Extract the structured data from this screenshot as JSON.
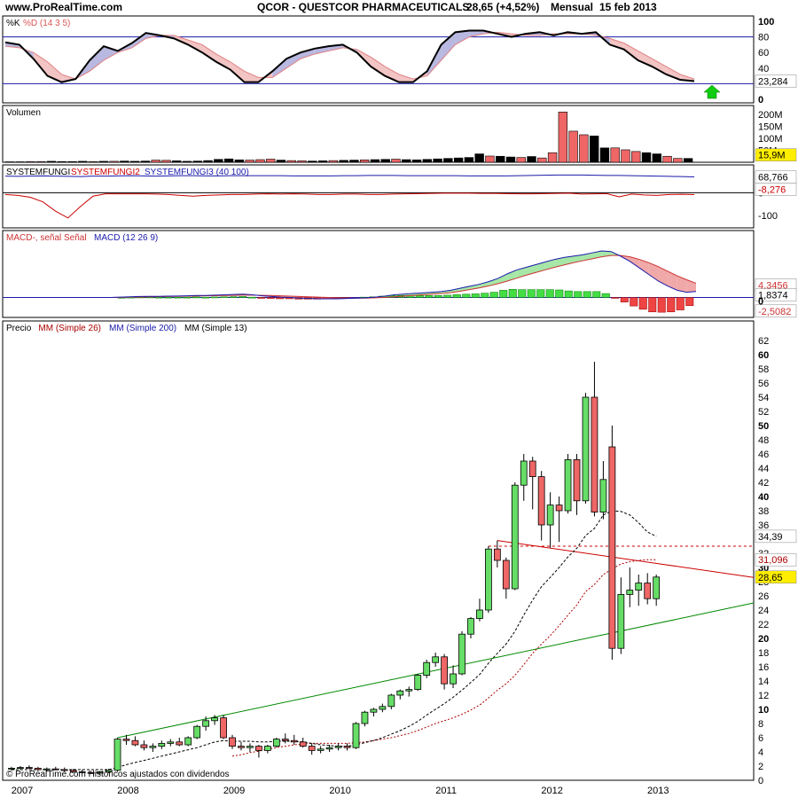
{
  "header": {
    "site": "www.ProRealTime.com",
    "instrument": "QCOR - QUESTCOR PHARMACEUTICALS",
    "price_change": "28,65 (+4,52%)",
    "period": "Mensual",
    "date": "15 feb 2013"
  },
  "footer_note": "© ProRealTime.com  Históricos ajustados con dividendos",
  "colors": {
    "up": "#66dd66",
    "down": "#ee6666",
    "frame": "#000000",
    "blue": "#1a1aaa",
    "red": "#cc0000",
    "green": "#008800"
  },
  "panels": {
    "stoch": {
      "label_k": "%K",
      "label_d": "%D (14 3 5)",
      "ticks": [
        "100",
        "80",
        "60",
        "40",
        "20",
        "0"
      ],
      "value": "23,284"
    },
    "volume": {
      "label": "Volumen",
      "ticks": [
        "200M",
        "150M",
        "100M",
        "50M"
      ],
      "value": "15,9M"
    },
    "systemfungi": {
      "label_1": "SYSTEMFUNGI",
      "label_2": "SYSTEMFUNGI2",
      "label_3": "SYSTEMFUNGI3 (40 100)",
      "ticks": [
        "0",
        "-100"
      ],
      "value_1": "68,766",
      "value_2": "-8,276"
    },
    "macd": {
      "label_1": "MACD-, señal",
      "label_2": "Señal",
      "label_3": "MACD (12 26 9)",
      "ticks": [
        "0"
      ],
      "value_1": "4,3456",
      "value_2": "1,8374",
      "value_3": "-2,5082"
    },
    "price": {
      "label_1": "Precio",
      "label_2": "MM (Simple 26)",
      "label_3": "MM (Simple 200)",
      "label_4": "MM (Simple 13)",
      "value_ma13": "34,39",
      "value_ma26": "31,096",
      "value_last": "28,65"
    }
  },
  "chart_data": {
    "type": "candlestick",
    "x_labels": [
      "2007",
      "2008",
      "2009",
      "2010",
      "2011",
      "2012",
      "2013"
    ],
    "y_ticks": [
      0,
      2,
      4,
      6,
      8,
      10,
      12,
      14,
      16,
      18,
      20,
      22,
      24,
      26,
      28,
      30,
      32,
      34,
      36,
      38,
      40,
      42,
      44,
      46,
      48,
      50,
      52,
      54,
      56,
      58,
      60,
      62
    ],
    "y_range": [
      0,
      63
    ],
    "start_year": 2007,
    "candles_ohlc": [
      [
        1.6,
        1.9,
        1.4,
        1.7
      ],
      [
        1.7,
        2.0,
        1.5,
        1.8
      ],
      [
        1.8,
        2.1,
        1.6,
        1.7
      ],
      [
        1.7,
        1.9,
        1.3,
        1.5
      ],
      [
        1.5,
        1.8,
        1.2,
        1.6
      ],
      [
        1.6,
        1.9,
        1.4,
        1.5
      ],
      [
        1.5,
        1.8,
        1.2,
        1.4
      ],
      [
        1.4,
        1.6,
        1.1,
        1.2
      ],
      [
        1.2,
        1.5,
        1.0,
        1.1
      ],
      [
        1.1,
        1.3,
        0.9,
        1.0
      ],
      [
        1.0,
        1.3,
        0.8,
        1.2
      ],
      [
        1.2,
        1.6,
        1.0,
        1.4
      ],
      [
        1.4,
        6.0,
        1.2,
        5.8
      ],
      [
        5.8,
        6.4,
        5.0,
        5.6
      ],
      [
        5.6,
        6.2,
        4.8,
        5.0
      ],
      [
        5.0,
        5.6,
        4.2,
        4.6
      ],
      [
        4.6,
        5.2,
        4.0,
        4.8
      ],
      [
        4.8,
        5.6,
        4.4,
        5.2
      ],
      [
        5.2,
        5.8,
        4.8,
        5.4
      ],
      [
        5.4,
        6.0,
        4.8,
        5.0
      ],
      [
        5.0,
        6.2,
        4.8,
        6.0
      ],
      [
        6.0,
        7.8,
        5.8,
        7.6
      ],
      [
        7.6,
        9.0,
        7.0,
        8.4
      ],
      [
        8.4,
        9.2,
        7.8,
        8.8
      ],
      [
        8.8,
        9.2,
        5.8,
        6.0
      ],
      [
        6.0,
        6.4,
        4.4,
        4.8
      ],
      [
        4.8,
        5.4,
        4.2,
        4.6
      ],
      [
        4.6,
        5.2,
        4.0,
        4.8
      ],
      [
        4.8,
        5.0,
        3.2,
        4.2
      ],
      [
        4.2,
        5.0,
        3.8,
        4.8
      ],
      [
        4.8,
        6.0,
        4.6,
        5.8
      ],
      [
        5.8,
        6.6,
        5.2,
        5.6
      ],
      [
        5.6,
        6.4,
        5.0,
        5.4
      ],
      [
        5.4,
        6.0,
        4.6,
        4.8
      ],
      [
        4.8,
        5.2,
        3.6,
        4.2
      ],
      [
        4.2,
        4.8,
        3.8,
        4.4
      ],
      [
        4.4,
        5.0,
        4.0,
        4.6
      ],
      [
        4.6,
        5.2,
        4.2,
        4.8
      ],
      [
        4.8,
        5.2,
        4.2,
        4.6
      ],
      [
        4.6,
        8.2,
        4.4,
        8.0
      ],
      [
        8.0,
        9.8,
        7.6,
        9.6
      ],
      [
        9.6,
        10.2,
        9.0,
        10.0
      ],
      [
        10.0,
        10.8,
        9.6,
        10.4
      ],
      [
        10.4,
        12.2,
        10.0,
        12.0
      ],
      [
        12.0,
        12.8,
        11.4,
        12.6
      ],
      [
        12.6,
        13.2,
        11.8,
        12.8
      ],
      [
        12.8,
        15.0,
        12.6,
        14.8
      ],
      [
        14.8,
        17.0,
        14.4,
        16.6
      ],
      [
        16.6,
        18.0,
        16.0,
        17.4
      ],
      [
        17.4,
        17.8,
        12.8,
        13.6
      ],
      [
        13.6,
        16.2,
        13.0,
        15.0
      ],
      [
        15.0,
        21.0,
        14.8,
        20.6
      ],
      [
        20.6,
        23.0,
        20.0,
        22.8
      ],
      [
        22.8,
        25.6,
        22.4,
        24.0
      ],
      [
        24.0,
        33.0,
        23.6,
        32.6
      ],
      [
        32.6,
        33.8,
        30.0,
        31.0
      ],
      [
        31.0,
        31.4,
        25.6,
        27.0
      ],
      [
        27.0,
        42.0,
        26.8,
        41.6
      ],
      [
        41.6,
        46.0,
        39.4,
        45.0
      ],
      [
        45.0,
        45.6,
        38.2,
        42.8
      ],
      [
        42.8,
        43.6,
        33.8,
        36.0
      ],
      [
        36.0,
        40.6,
        32.8,
        38.8
      ],
      [
        38.8,
        40.0,
        33.6,
        38.0
      ],
      [
        38.0,
        46.0,
        37.6,
        45.2
      ],
      [
        45.2,
        46.0,
        37.4,
        39.4
      ],
      [
        39.4,
        54.6,
        39.0,
        54.0
      ],
      [
        54.0,
        59.0,
        37.2,
        37.8
      ],
      [
        37.8,
        45.0,
        36.8,
        42.4
      ],
      [
        47.0,
        50.0,
        17.0,
        18.6
      ],
      [
        18.6,
        28.6,
        17.8,
        26.2
      ],
      [
        26.2,
        30.0,
        24.4,
        26.8
      ],
      [
        26.8,
        29.0,
        24.6,
        27.8
      ],
      [
        27.8,
        29.2,
        24.8,
        25.6
      ],
      [
        25.6,
        29.0,
        24.6,
        28.65
      ]
    ],
    "ma13": [
      1.5,
      1.5,
      1.5,
      1.5,
      1.5,
      1.5,
      1.5,
      1.5,
      1.5,
      1.5,
      1.5,
      1.5,
      1.8,
      2.2,
      2.5,
      2.8,
      3.1,
      3.4,
      3.7,
      4.0,
      4.3,
      4.6,
      5.0,
      5.4,
      5.6,
      5.5,
      5.5,
      5.5,
      5.4,
      5.4,
      5.5,
      5.5,
      5.5,
      5.4,
      5.2,
      5.0,
      4.9,
      4.8,
      4.8,
      5.0,
      5.3,
      5.6,
      6.0,
      6.5,
      7.0,
      7.6,
      8.3,
      9.2,
      10.0,
      10.8,
      11.7,
      12.7,
      13.8,
      14.9,
      16.5,
      17.9,
      19.2,
      21.0,
      23.3,
      25.4,
      27.3,
      28.6,
      30.0,
      31.5,
      32.7,
      34.5,
      35.5,
      37.4,
      38.0,
      37.9,
      37.4,
      36.3,
      35.0,
      34.39
    ],
    "ma26": [
      null,
      null,
      null,
      null,
      null,
      null,
      null,
      null,
      null,
      null,
      null,
      null,
      null,
      null,
      null,
      null,
      null,
      null,
      null,
      null,
      null,
      null,
      null,
      null,
      null,
      3.4,
      3.6,
      3.9,
      4.1,
      4.4,
      4.6,
      4.8,
      5.0,
      5.1,
      5.2,
      5.2,
      5.2,
      5.2,
      5.2,
      5.3,
      5.4,
      5.6,
      5.8,
      6.0,
      6.3,
      6.6,
      7.0,
      7.5,
      8.0,
      8.4,
      8.8,
      9.3,
      9.9,
      10.6,
      11.6,
      12.7,
      13.6,
      14.8,
      16.3,
      17.9,
      19.2,
      20.4,
      21.8,
      23.3,
      24.7,
      26.6,
      27.6,
      29.0,
      29.8,
      30.5,
      30.8,
      31.0,
      31.1,
      31.096
    ],
    "trend_support": [
      [
        12.0,
        6.0
      ],
      [
        73.0,
        25.0
      ]
    ],
    "trend_resistance": [
      [
        55.0,
        33.8
      ],
      [
        74.0,
        28.6
      ]
    ],
    "resistance_level": 33.0,
    "stoch_k": [
      73,
      70,
      52,
      30,
      22,
      26,
      50,
      68,
      62,
      72,
      85,
      82,
      78,
      70,
      60,
      48,
      38,
      22,
      22,
      36,
      52,
      60,
      65,
      68,
      70,
      60,
      42,
      30,
      22,
      22,
      36,
      70,
      86,
      88,
      88,
      84,
      80,
      84,
      86,
      82,
      86,
      84,
      86,
      70,
      64,
      50,
      42,
      32,
      25,
      23.3
    ],
    "stoch_d": [
      68,
      66,
      60,
      48,
      32,
      26,
      36,
      50,
      60,
      66,
      78,
      82,
      82,
      76,
      70,
      58,
      48,
      36,
      28,
      28,
      40,
      52,
      58,
      62,
      66,
      64,
      54,
      42,
      32,
      26,
      30,
      50,
      70,
      80,
      84,
      86,
      84,
      82,
      82,
      84,
      84,
      84,
      82,
      78,
      72,
      62,
      52,
      42,
      32,
      26
    ],
    "volume_millions": [
      2,
      2,
      3,
      3,
      4,
      3,
      3,
      4,
      3,
      4,
      4,
      5,
      4,
      5,
      9,
      8,
      6,
      4,
      5,
      7,
      12,
      14,
      10,
      9,
      11,
      13,
      9,
      7,
      6,
      5,
      6,
      7,
      8,
      9,
      10,
      11,
      12,
      13,
      11,
      10,
      12,
      14,
      16,
      18,
      20,
      35,
      26,
      25,
      22,
      20,
      24,
      18,
      40,
      210,
      130,
      115,
      110,
      60,
      60,
      52,
      45,
      40,
      35,
      25,
      16,
      15.9
    ],
    "volume_up": [
      false,
      false,
      false,
      false,
      true,
      true,
      true,
      true,
      false,
      true,
      false,
      true,
      true,
      true,
      false,
      false,
      true,
      true,
      true,
      true,
      true,
      true,
      true,
      false,
      false,
      false,
      true,
      false,
      false,
      true,
      true,
      false,
      true,
      true,
      false,
      true,
      true,
      false,
      true,
      true,
      true,
      true,
      true,
      true,
      true,
      true,
      false,
      true,
      true,
      false,
      true,
      false,
      false,
      false,
      false,
      false,
      true,
      true,
      false,
      false,
      false,
      true,
      true,
      false,
      false,
      true
    ],
    "systemfungi_main": [
      72,
      71,
      72,
      73,
      72,
      71,
      70,
      72,
      72,
      73,
      74,
      73,
      72,
      73,
      74,
      74,
      73,
      73,
      74,
      74,
      74,
      74,
      74,
      73,
      73,
      73,
      73,
      74,
      74,
      75,
      75,
      75,
      74,
      74,
      74,
      74,
      74,
      73,
      73,
      73,
      73,
      74,
      75,
      76,
      77,
      77,
      77,
      76,
      75,
      75,
      74,
      73,
      72,
      71,
      70,
      69
    ],
    "systemfungi_red": [
      -8,
      -12,
      -20,
      -40,
      -80,
      -110,
      -60,
      -15,
      -5,
      -5,
      -5,
      -5,
      -6,
      -8,
      -12,
      -15,
      -12,
      -10,
      -8,
      -8,
      -6,
      -5,
      -6,
      -5,
      -6,
      -8,
      -8,
      -6,
      -6,
      -8,
      -8,
      -6,
      -5,
      -4,
      -3,
      -2,
      -2,
      -2,
      -3,
      -3,
      -4,
      -5,
      -5,
      -4,
      -3,
      -2,
      -6,
      -5,
      -4,
      -18,
      -6,
      -10,
      -12,
      -8,
      -7,
      -8.3
    ],
    "macd_line": [
      0,
      0,
      0,
      0,
      0,
      0,
      0,
      0,
      0,
      0,
      0,
      0,
      0.1,
      0.2,
      0.3,
      0.35,
      0.35,
      0.4,
      0.45,
      0.5,
      0.6,
      0.6,
      0.7,
      0.8,
      0.9,
      1.0,
      0.8,
      0.5,
      0.3,
      0.1,
      0,
      -0.2,
      -0.3,
      -0.4,
      -0.4,
      -0.4,
      -0.3,
      -0.2,
      -0.1,
      0.1,
      0.4,
      0.8,
      1.0,
      1.2,
      1.4,
      1.6,
      1.8,
      2.2,
      2.8,
      3.4,
      4.0,
      4.8,
      5.8,
      7.2,
      8.4,
      9.2,
      10.0,
      10.8,
      11.6,
      12.2,
      12.6,
      13.0,
      13.6,
      14.2,
      14.0,
      12.6,
      11.0,
      9.0,
      7.0,
      5.0,
      3.5,
      2.2,
      1.6,
      1.8374
    ],
    "macd_signal": [
      0,
      0,
      0,
      0,
      0,
      0,
      0,
      0,
      0,
      0,
      0,
      0,
      0.05,
      0.1,
      0.15,
      0.2,
      0.25,
      0.3,
      0.35,
      0.4,
      0.45,
      0.5,
      0.55,
      0.6,
      0.65,
      0.7,
      0.7,
      0.65,
      0.6,
      0.5,
      0.4,
      0.3,
      0.2,
      0.1,
      0,
      -0.1,
      -0.15,
      -0.2,
      -0.2,
      -0.1,
      0,
      0.2,
      0.4,
      0.6,
      0.8,
      1.0,
      1.2,
      1.5,
      1.9,
      2.4,
      2.9,
      3.5,
      4.2,
      5.0,
      5.9,
      6.8,
      7.6,
      8.4,
      9.2,
      9.9,
      10.6,
      11.2,
      11.8,
      12.4,
      12.8,
      12.8,
      12.4,
      11.6,
      10.6,
      9.4,
      8.0,
      6.6,
      5.4,
      4.3456
    ],
    "macd_histogram": [
      0,
      0,
      0,
      0,
      0,
      0,
      0,
      0,
      0,
      0,
      0,
      0,
      0.05,
      0.1,
      0.15,
      0.15,
      0.1,
      0.1,
      0.1,
      0.1,
      0.15,
      0.1,
      0.15,
      0.2,
      0.25,
      0.3,
      0.1,
      -0.15,
      -0.3,
      -0.4,
      -0.4,
      -0.5,
      -0.5,
      -0.5,
      -0.4,
      -0.3,
      -0.15,
      0,
      0.1,
      0.2,
      0.4,
      0.6,
      0.6,
      0.6,
      0.6,
      0.6,
      0.6,
      0.7,
      0.9,
      1.0,
      1.1,
      1.3,
      1.6,
      2.2,
      2.5,
      2.4,
      2.4,
      2.4,
      2.4,
      2.3,
      2.0,
      1.8,
      1.8,
      1.8,
      1.2,
      -0.2,
      -1.4,
      -2.6,
      -3.6,
      -4.4,
      -4.5,
      -4.4,
      -3.8,
      -2.5082
    ]
  }
}
